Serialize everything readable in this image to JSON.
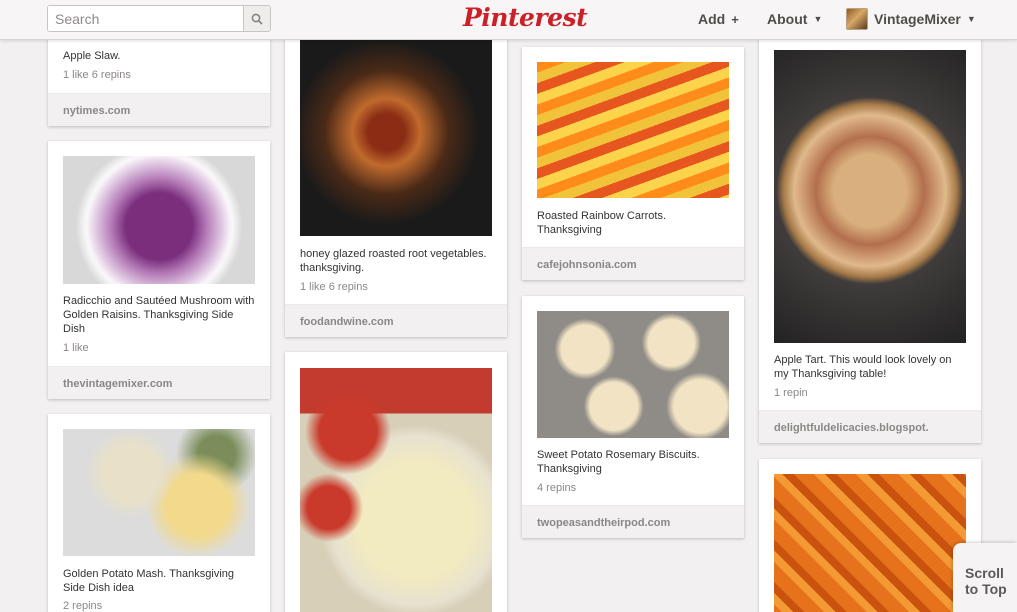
{
  "header": {
    "search_placeholder": "Search",
    "logo": "Pinterest",
    "add_label": "Add",
    "about_label": "About",
    "username": "VintageMixer"
  },
  "pins": {
    "apple_slaw": {
      "desc": "Apple Slaw.",
      "stats": "1 like  6 repins",
      "source": "nytimes.com"
    },
    "radicchio": {
      "desc": "Radicchio and Sautéed Mushroom with Golden Raisins. Thanksgiving Side Dish",
      "stats": "1 like",
      "source": "thevintagemixer.com"
    },
    "golden_potato": {
      "desc": "Golden Potato Mash. Thanksgiving Side Dish idea",
      "stats": "2 repins"
    },
    "root_veg": {
      "desc": "honey glazed roasted root vegetables. thanksgiving.",
      "stats": "1 like  6 repins",
      "source": "foodandwine.com"
    },
    "rainbow_carrots": {
      "desc": "Roasted Rainbow Carrots. Thanksgiving",
      "source": "cafejohnsonia.com"
    },
    "biscuits": {
      "desc": "Sweet Potato Rosemary Biscuits. Thanksgiving",
      "stats": "4 repins",
      "source": "twopeasandtheirpod.com"
    },
    "apple_tart": {
      "desc": "Apple Tart. This would look lovely on my Thanksgiving table!",
      "stats": "1 repin",
      "source": "delightfuldelicacies.blogspot."
    }
  },
  "scroll_to_top": {
    "line1": "Scroll",
    "line2": "to Top"
  },
  "colors": {
    "brand": "#cb2027",
    "background": "#f2f0f0"
  }
}
